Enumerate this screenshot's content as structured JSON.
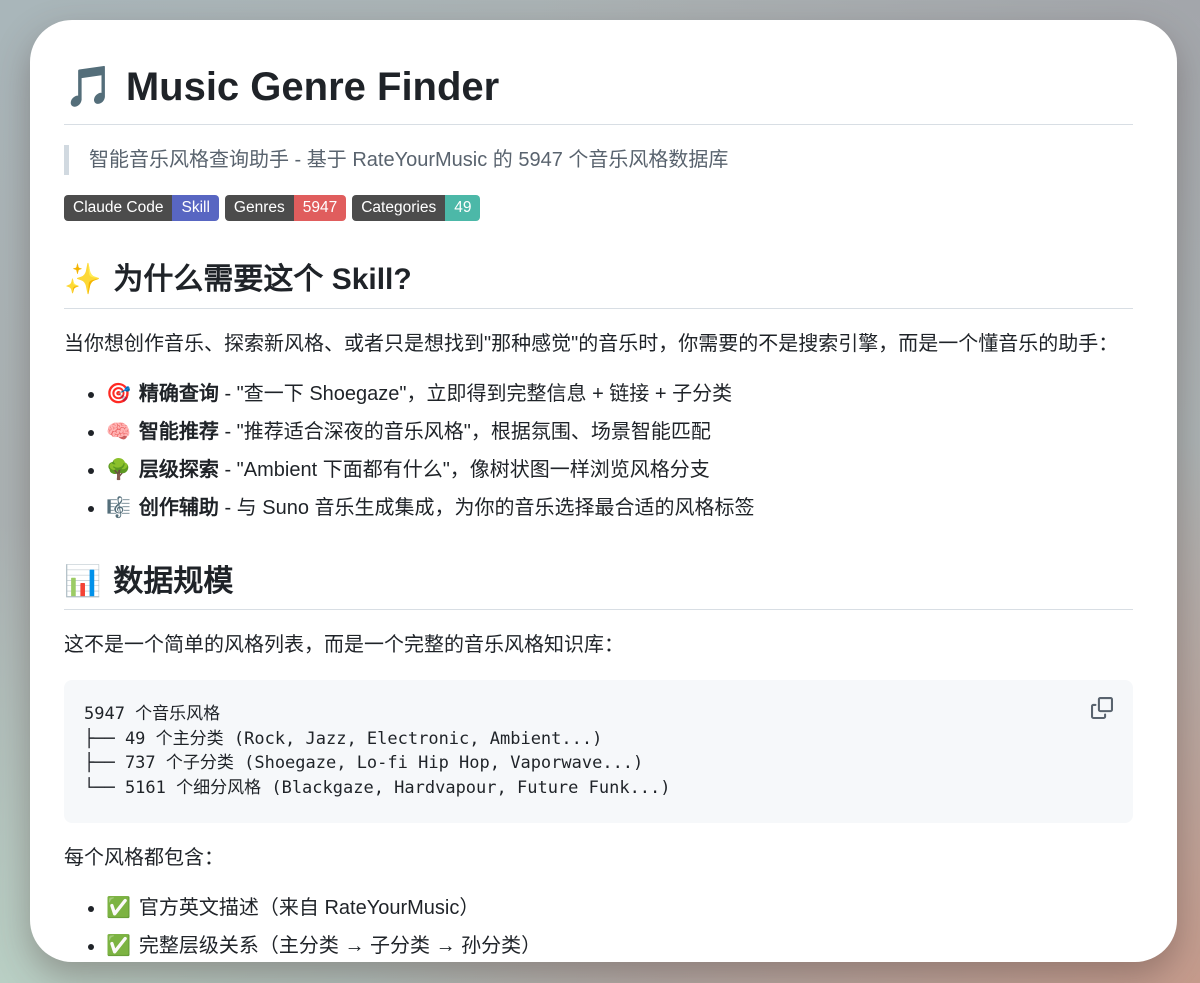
{
  "header": {
    "emoji": "🎵",
    "title": "Music Genre Finder"
  },
  "blockquote": "智能音乐风格查询助手 - 基于 RateYourMusic 的 5947 个音乐风格数据库",
  "badges": [
    {
      "label": "Claude Code",
      "value": "Skill",
      "label_color": "#4c4c4c",
      "value_color": "#5866c2"
    },
    {
      "label": "Genres",
      "value": "5947",
      "label_color": "#4c4c4c",
      "value_color": "#e05d5d"
    },
    {
      "label": "Categories",
      "value": "49",
      "label_color": "#4c4c4c",
      "value_color": "#4cb8a8"
    }
  ],
  "why_section": {
    "emoji": "✨",
    "heading": "为什么需要这个 Skill?",
    "intro": "当你想创作音乐、探索新风格、或者只是想找到\"那种感觉\"的音乐时，你需要的不是搜索引擎，而是一个懂音乐的助手：",
    "items": [
      {
        "emoji": "🎯",
        "label": "精确查询",
        "rest": " - \"查一下 Shoegaze\"，立即得到完整信息 + 链接 + 子分类"
      },
      {
        "emoji": "🧠",
        "label": "智能推荐",
        "rest": " - \"推荐适合深夜的音乐风格\"，根据氛围、场景智能匹配"
      },
      {
        "emoji": "🌳",
        "label": "层级探索",
        "rest": " - \"Ambient 下面都有什么\"，像树状图一样浏览风格分支"
      },
      {
        "emoji": "🎼",
        "label": "创作辅助",
        "rest": " - 与 Suno 音乐生成集成，为你的音乐选择最合适的风格标签"
      }
    ]
  },
  "data_section": {
    "emoji": "📊",
    "heading": "数据规模",
    "intro": "这不是一个简单的风格列表，而是一个完整的音乐风格知识库：",
    "code": "5947 个音乐风格\n├── 49 个主分类 (Rock, Jazz, Electronic, Ambient...)\n├── 737 个子分类 (Shoegaze, Lo-fi Hip Hop, Vaporwave...)\n└── 5161 个细分风格 (Blackgaze, Hardvapour, Future Funk...)",
    "includes_intro": "每个风格都包含：",
    "includes": [
      {
        "emoji": "✅",
        "text": "官方英文描述（来自 RateYourMusic）"
      },
      {
        "emoji": "✅",
        "text": "完整层级关系（主分类 → 子分类 → 孙分类）"
      }
    ]
  }
}
